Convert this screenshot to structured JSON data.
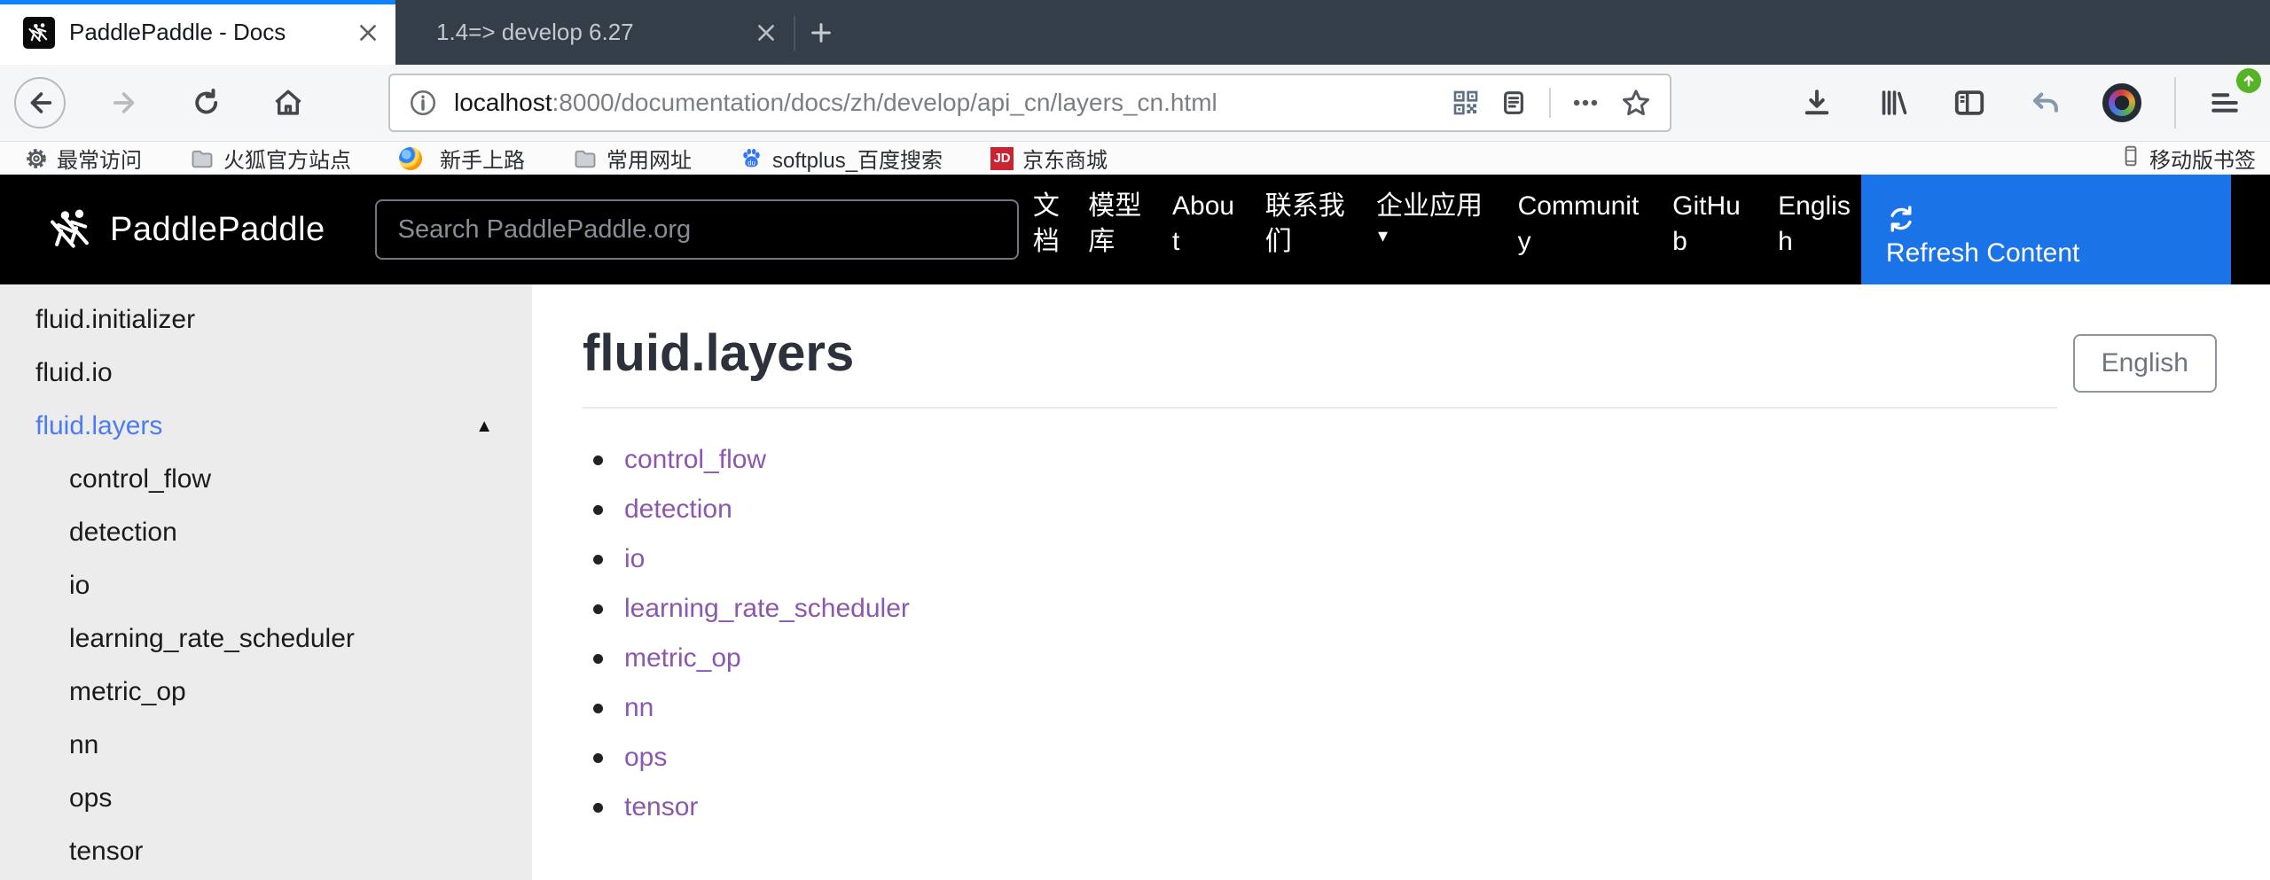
{
  "colors": {
    "tab_accent": "#0a84ff",
    "refresh_blue": "#1b73e8",
    "sidebar_active_blue": "#4c7bf4",
    "visited_link_purple": "#8d57ad",
    "jd_red": "#c9242f",
    "update_badge_green": "#54b424"
  },
  "browser": {
    "tabs": [
      {
        "title": "PaddlePaddle - Docs"
      },
      {
        "title": "1.4=> develop 6.27"
      }
    ],
    "url": {
      "host": "localhost",
      "path": ":8000/documentation/docs/zh/develop/api_cn/layers_cn.html"
    },
    "bookmarks": [
      {
        "label": "最常访问"
      },
      {
        "label": "火狐官方站点"
      },
      {
        "label": "新手上路"
      },
      {
        "label": "常用网址"
      },
      {
        "label": "softplus_百度搜索"
      },
      {
        "label": "京东商城"
      }
    ],
    "bookmarks_right": {
      "label": "移动版书签"
    },
    "jd_label": "JD",
    "baidu_label": "du"
  },
  "site": {
    "brand": "PaddlePaddle",
    "search_placeholder": "Search PaddlePaddle.org",
    "nav": [
      {
        "label": "文档"
      },
      {
        "label": "模型库"
      },
      {
        "label": "About"
      },
      {
        "label": "联系我们"
      },
      {
        "label": "企业应用",
        "caret": "▾"
      },
      {
        "label": "Community"
      },
      {
        "label": "GitHub"
      },
      {
        "label": "English"
      }
    ],
    "refresh_label": "Refresh Content"
  },
  "sidebar": {
    "items": [
      {
        "label": "fluid.initializer",
        "level": 1
      },
      {
        "label": "fluid.io",
        "level": 1
      },
      {
        "label": "fluid.layers",
        "level": 1,
        "active": true,
        "arrow": "▲"
      },
      {
        "label": "control_flow",
        "level": 2
      },
      {
        "label": "detection",
        "level": 2
      },
      {
        "label": "io",
        "level": 2
      },
      {
        "label": "learning_rate_scheduler",
        "level": 2
      },
      {
        "label": "metric_op",
        "level": 2
      },
      {
        "label": "nn",
        "level": 2
      },
      {
        "label": "ops",
        "level": 2
      },
      {
        "label": "tensor",
        "level": 2
      }
    ]
  },
  "content": {
    "title": "fluid.layers",
    "lang_button": "English",
    "links": [
      {
        "label": "control_flow"
      },
      {
        "label": "detection"
      },
      {
        "label": "io"
      },
      {
        "label": "learning_rate_scheduler"
      },
      {
        "label": "metric_op"
      },
      {
        "label": "nn"
      },
      {
        "label": "ops"
      },
      {
        "label": "tensor"
      }
    ]
  }
}
